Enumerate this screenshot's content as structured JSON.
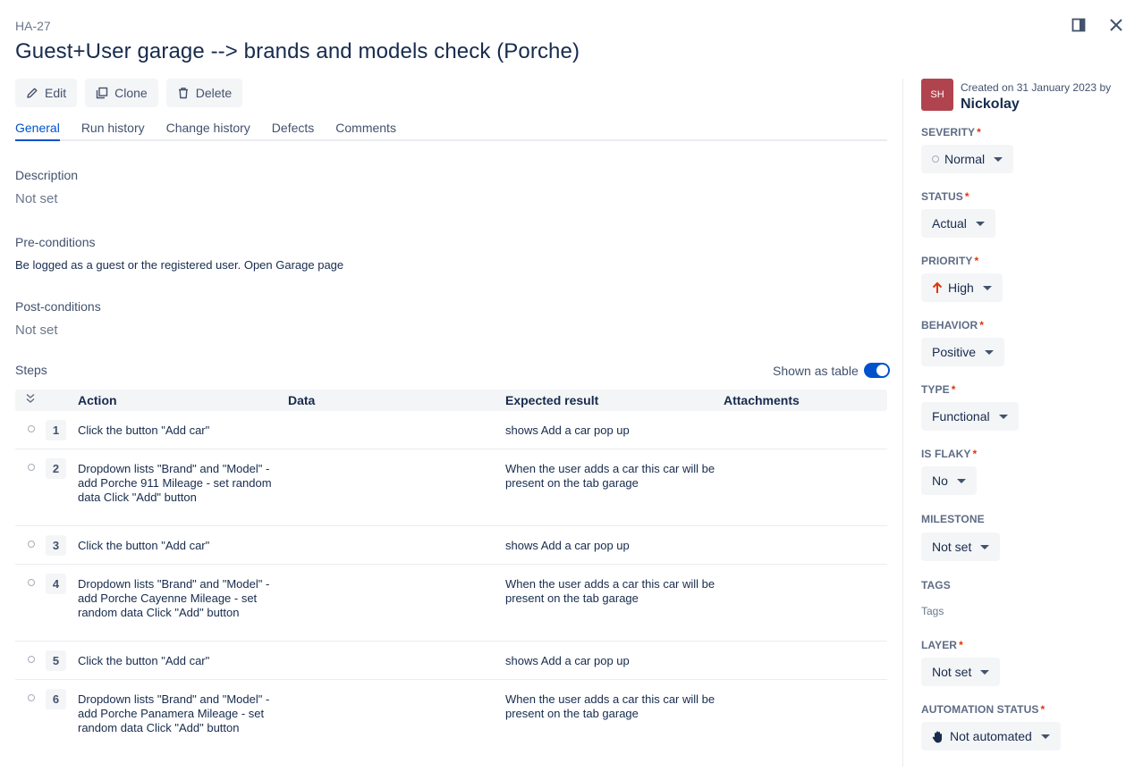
{
  "issue": {
    "key": "HA-27",
    "title": "Guest+User garage --> brands and models check (Porche)"
  },
  "toolbar": {
    "edit": "Edit",
    "clone": "Clone",
    "delete": "Delete"
  },
  "tabs": [
    "General",
    "Run history",
    "Change history",
    "Defects",
    "Comments"
  ],
  "sections": {
    "description_label": "Description",
    "description_value": "Not set",
    "preconditions_label": "Pre-conditions",
    "preconditions_value": "Be logged as a guest or the registered user. Open Garage page",
    "postconditions_label": "Post-conditions",
    "postconditions_value": "Not set",
    "steps_label": "Steps",
    "shown_as_table": "Shown as table"
  },
  "steps_table": {
    "columns": [
      "Action",
      "Data",
      "Expected result",
      "Attachments"
    ],
    "rows": [
      {
        "num": "1",
        "action": "Click the button \"Add car\"",
        "data": "",
        "expected": "shows Add a car pop up"
      },
      {
        "num": "2",
        "action": "Dropdown lists \"Brand\" and \"Model\" - add Porche 911 Mileage - set random data Click \"Add\" button",
        "data": "",
        "expected": "When the user adds a car this car will be present on the tab garage"
      },
      {
        "num": "3",
        "action": "Click the button \"Add car\"",
        "data": "",
        "expected": "shows Add a car pop up"
      },
      {
        "num": "4",
        "action": "Dropdown lists \"Brand\" and \"Model\" - add Porche Cayenne Mileage - set random data Click \"Add\" button",
        "data": "",
        "expected": "When the user adds a car this car will be present on the tab garage"
      },
      {
        "num": "5",
        "action": "Click the button \"Add car\"",
        "data": "",
        "expected": "shows Add a car pop up"
      },
      {
        "num": "6",
        "action": "Dropdown lists \"Brand\" and \"Model\" - add Porche Panamera Mileage - set random data Click \"Add\" button",
        "data": "",
        "expected": "When the user adds a car this car will be present on the tab garage"
      }
    ]
  },
  "sidebar": {
    "avatar_initials": "SH",
    "created_on": "Created on 31 January 2023 by",
    "creator": "Nickolay",
    "fields": {
      "severity": {
        "label": "SEVERITY",
        "value": "Normal"
      },
      "status": {
        "label": "STATUS",
        "value": "Actual"
      },
      "priority": {
        "label": "PRIORITY",
        "value": "High"
      },
      "behavior": {
        "label": "BEHAVIOR",
        "value": "Positive"
      },
      "type": {
        "label": "TYPE",
        "value": "Functional"
      },
      "is_flaky": {
        "label": "IS FLAKY",
        "value": "No"
      },
      "milestone": {
        "label": "MILESTONE",
        "value": "Not set"
      },
      "tags": {
        "label": "TAGS",
        "value": "Tags"
      },
      "layer": {
        "label": "LAYER",
        "value": "Not set"
      },
      "automation_status": {
        "label": "AUTOMATION STATUS",
        "value": "Not automated"
      }
    },
    "required_mark": "*"
  },
  "colors": {
    "accent": "#0052cc",
    "priority_high": "#de350b",
    "avatar": "#b0444e"
  },
  "icons": [
    "pencil-icon",
    "clone-icon",
    "trash-icon",
    "panel-icon",
    "close-icon",
    "collapse-icon",
    "arrow-up-icon",
    "hand-icon"
  ]
}
